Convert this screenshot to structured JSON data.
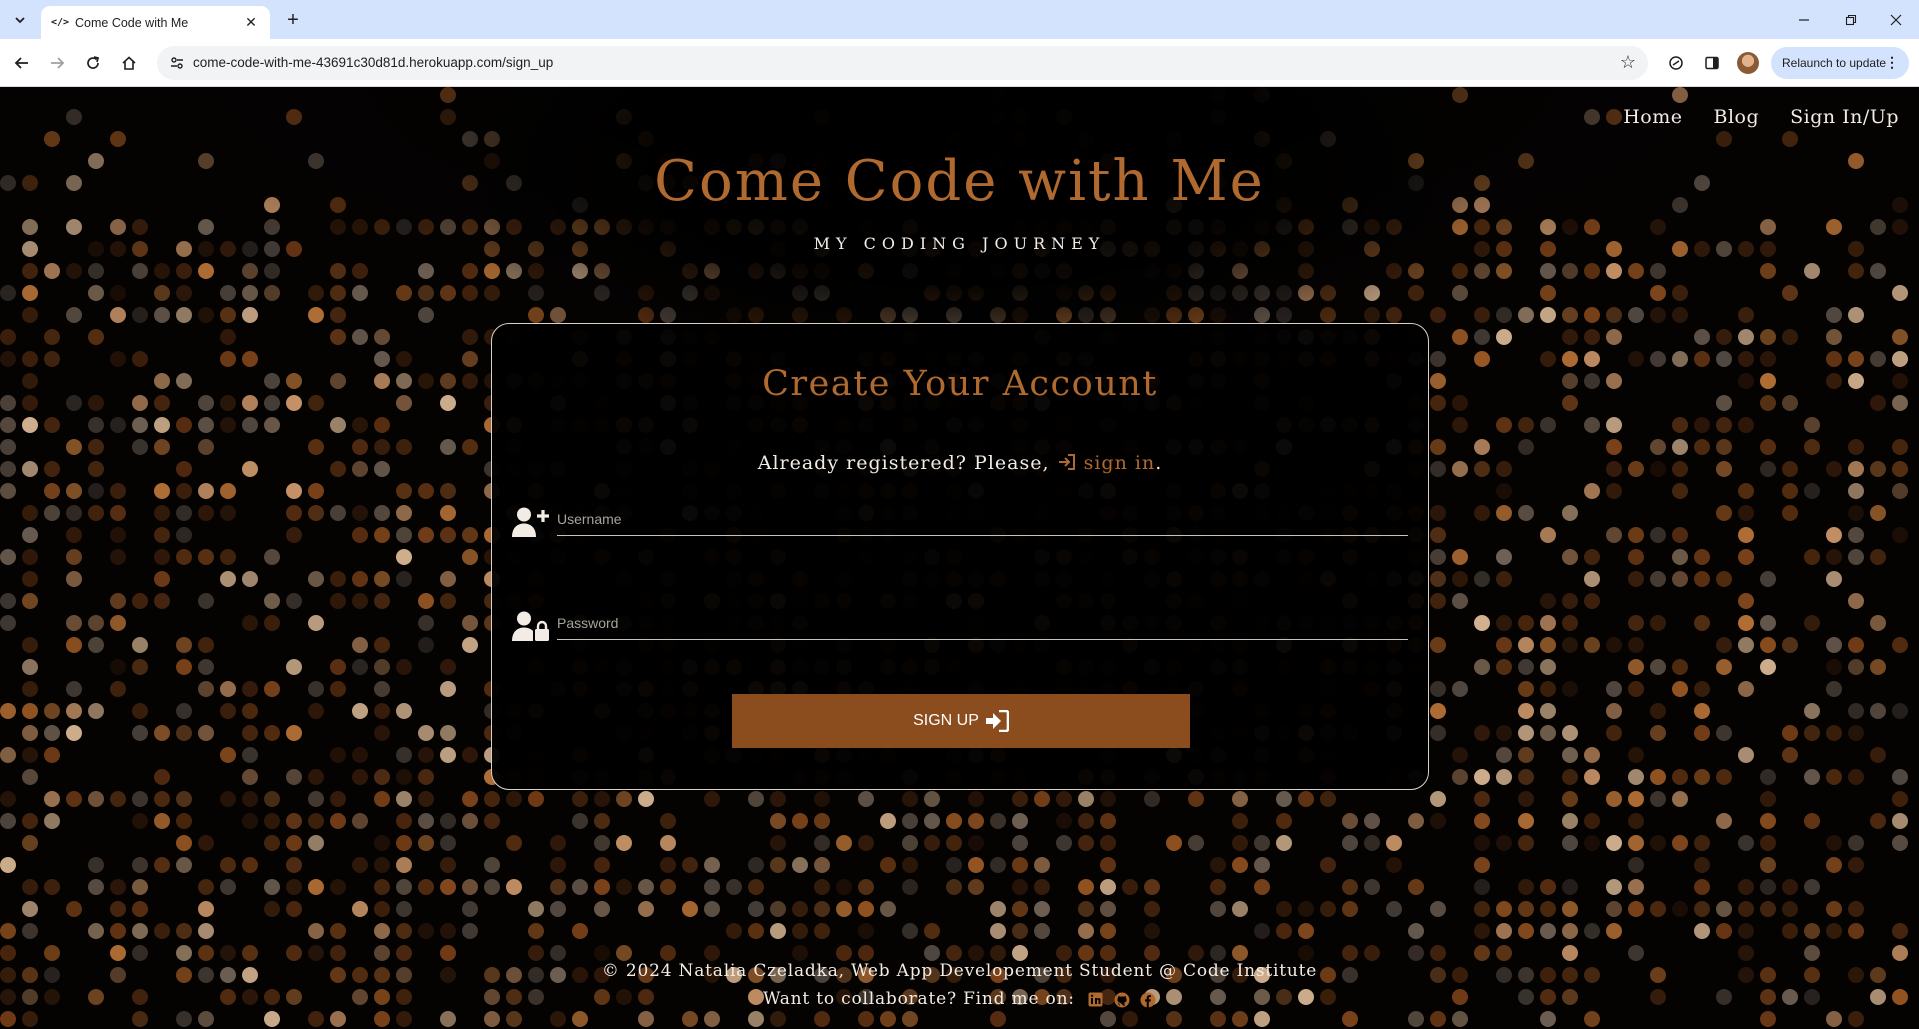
{
  "browser": {
    "tab_title": "Come Code with Me",
    "url": "come-code-with-me-43691c30d81d.herokuapp.com/sign_up",
    "relaunch_label": "Relaunch to update"
  },
  "nav": {
    "items": [
      {
        "label": "Home"
      },
      {
        "label": "Blog"
      },
      {
        "label": "Sign In/Up"
      }
    ]
  },
  "header": {
    "brand": "Come Code with Me",
    "tagline": "MY CODING JOURNEY"
  },
  "signup": {
    "title": "Create Your Account",
    "already_registered": "Already registered? Please,",
    "signin_link": "sign in",
    "period": ".",
    "username_placeholder": "Username",
    "password_placeholder": "Password",
    "submit_label": "SIGN UP"
  },
  "footer": {
    "copyright": "© 2024 Natalia Czeladka, Web App Developement Student @ Code Institute",
    "collaborate": "Want to collaborate? Find me on:",
    "social_icons": [
      "linkedin-icon",
      "github-icon",
      "facebook-icon"
    ]
  },
  "colors": {
    "accent": "#b06a2f",
    "button": "#8b4c1e",
    "text": "#f3ece4",
    "background": "#000000"
  }
}
